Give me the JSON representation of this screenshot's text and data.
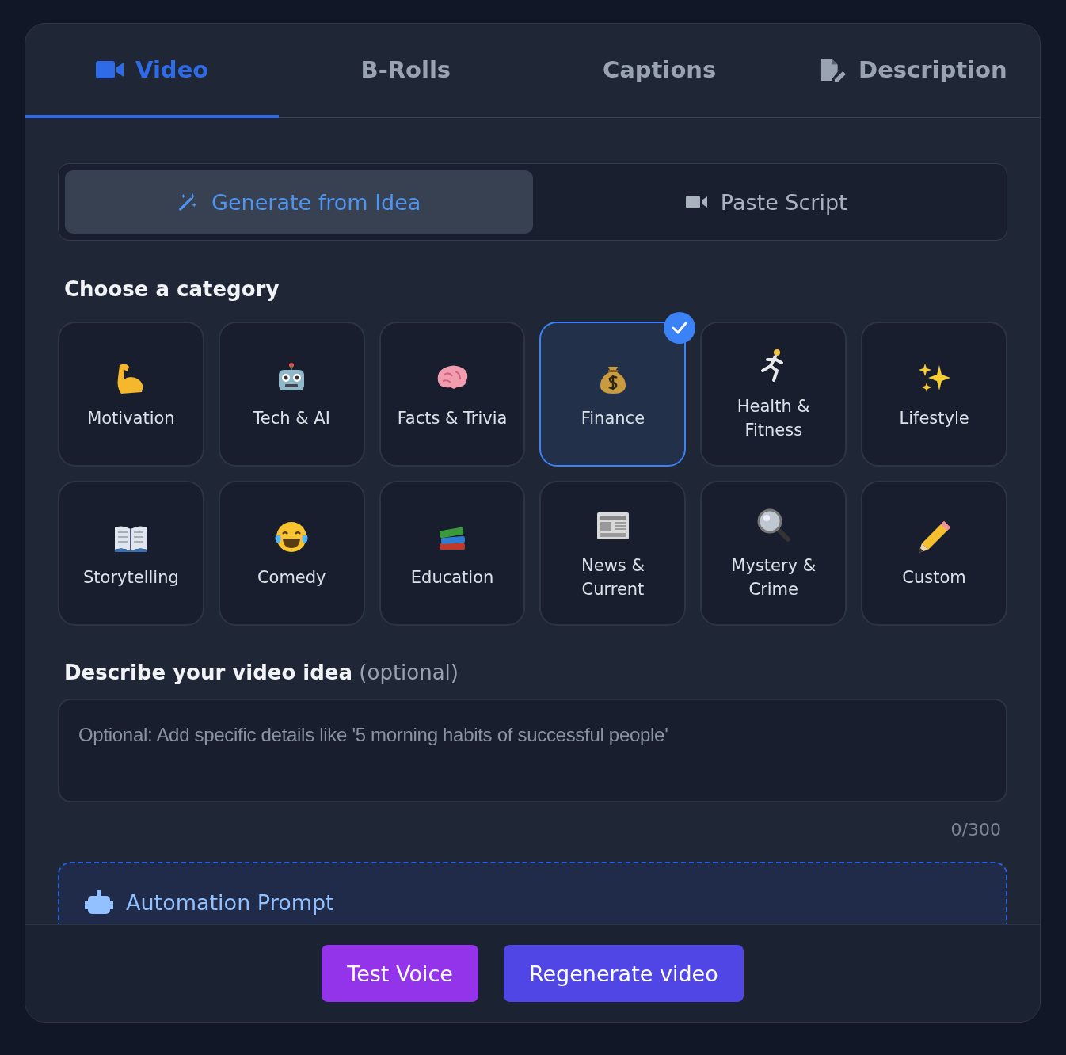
{
  "tabs": [
    {
      "label": "Video",
      "selected": true,
      "kind": "camera"
    },
    {
      "label": "B-Rolls",
      "selected": false,
      "kind": "none"
    },
    {
      "label": "Captions",
      "selected": false,
      "kind": "none"
    },
    {
      "label": "Description",
      "selected": false,
      "kind": "document"
    }
  ],
  "modes": [
    {
      "label": "Generate from Idea",
      "selected": true,
      "kind": "wand"
    },
    {
      "label": "Paste Script",
      "selected": false,
      "kind": "camera"
    }
  ],
  "category_heading": "Choose a category",
  "categories": [
    {
      "label": "Motivation",
      "selected": false
    },
    {
      "label": "Tech & AI",
      "selected": false
    },
    {
      "label": "Facts & Trivia",
      "selected": false
    },
    {
      "label": "Finance",
      "selected": true
    },
    {
      "label": "Health & Fitness",
      "selected": false
    },
    {
      "label": "Lifestyle",
      "selected": false
    },
    {
      "label": "Storytelling",
      "selected": false
    },
    {
      "label": "Comedy",
      "selected": false
    },
    {
      "label": "Education",
      "selected": false
    },
    {
      "label": "News & Current",
      "selected": false
    },
    {
      "label": "Mystery & Crime",
      "selected": false
    },
    {
      "label": "Custom",
      "selected": false
    }
  ],
  "idea": {
    "label": "Describe your video idea",
    "hint": "(optional)",
    "placeholder": "Optional: Add specific details like '5 morning habits of successful people'",
    "counter": "0/300"
  },
  "automation": {
    "title": "Automation Prompt"
  },
  "buttons": [
    {
      "label": "Test Voice",
      "kind": "secondary"
    },
    {
      "label": "Regenerate video",
      "kind": "primary"
    }
  ]
}
